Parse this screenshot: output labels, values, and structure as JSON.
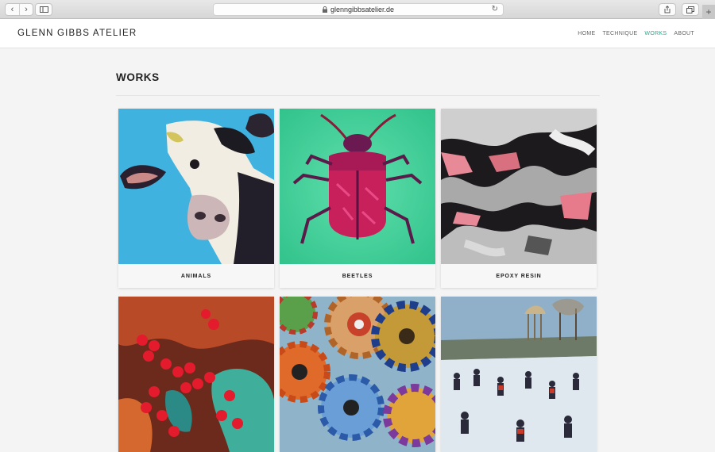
{
  "browser": {
    "url": "glenngibbsatelier.de"
  },
  "site": {
    "brand": "GLENN GIBBS ATELIER",
    "nav": [
      "HOME",
      "TECHNIQUE",
      "WORKS",
      "ABOUT"
    ],
    "active_nav": "WORKS",
    "accent_color": "#2aa88c"
  },
  "page": {
    "title": "WORKS"
  },
  "gallery": [
    {
      "label": "ANIMALS",
      "image": "cow-painting"
    },
    {
      "label": "BEETLES",
      "image": "beetle-painting"
    },
    {
      "label": "EPOXY RESIN",
      "image": "abstract-resin-painting"
    },
    {
      "label": "",
      "image": "red-berries-painting"
    },
    {
      "label": "",
      "image": "gears-painting"
    },
    {
      "label": "",
      "image": "ice-skaters-painting"
    }
  ]
}
